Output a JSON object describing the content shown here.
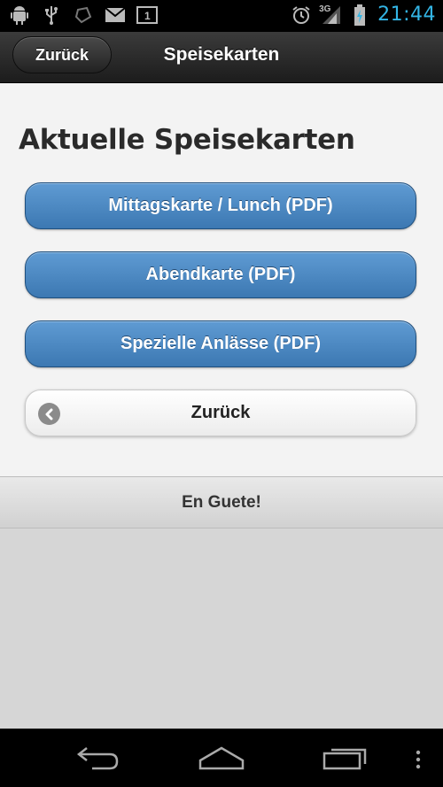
{
  "status_bar": {
    "notifications": [
      "android-debug-icon",
      "usb-icon",
      "sync-icon",
      "mail-icon",
      "calendar-icon"
    ],
    "calendar_day": "1",
    "network_type": "3G",
    "time": "21:44",
    "accent_color": "#33b5e5"
  },
  "header": {
    "back_label": "Zurück",
    "title": "Speisekarten"
  },
  "main": {
    "title": "Aktuelle Speisekarten",
    "buttons": [
      {
        "label": "Mittagskarte / Lunch (PDF)"
      },
      {
        "label": "Abendkarte (PDF)"
      },
      {
        "label": "Spezielle Anlässe (PDF)"
      }
    ],
    "back_button_label": "Zurück"
  },
  "footer": {
    "text": "En Guete!"
  },
  "nav_bar": {
    "items": [
      "back-icon",
      "home-icon",
      "recent-apps-icon",
      "menu-icon"
    ]
  }
}
